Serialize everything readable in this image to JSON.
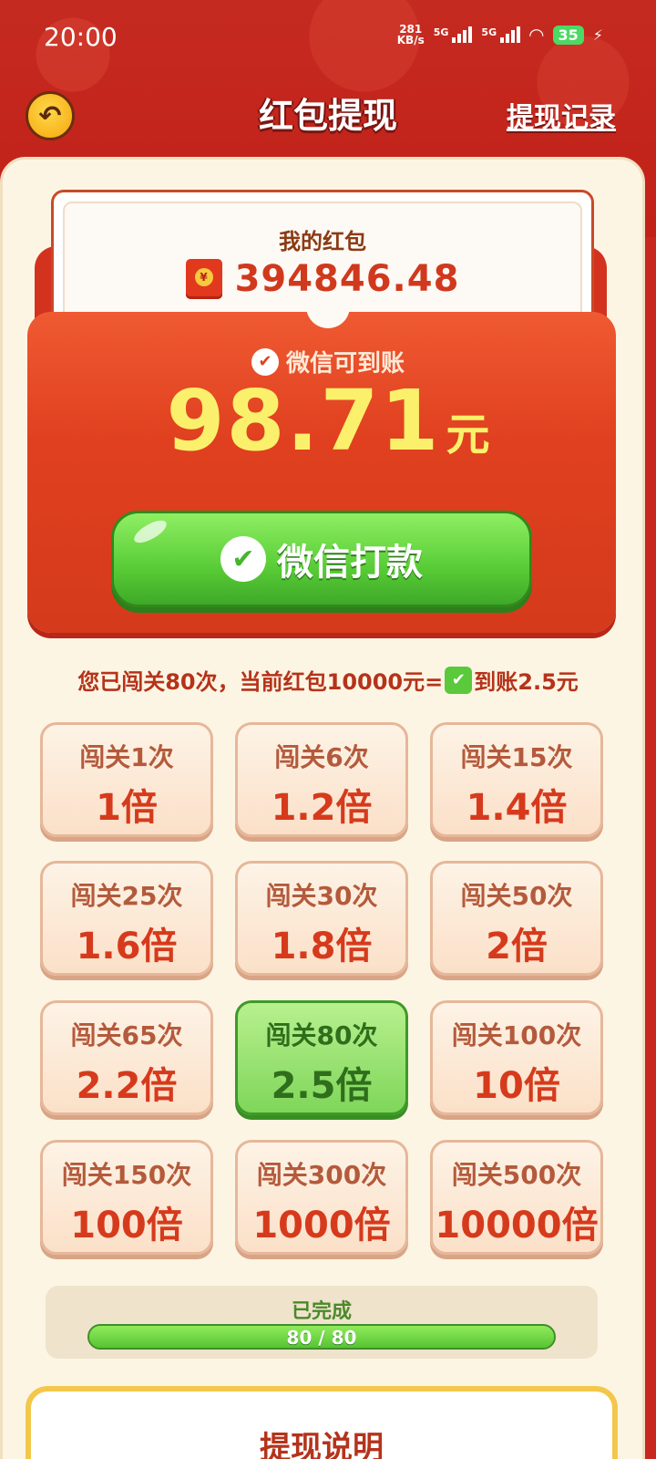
{
  "status_bar": {
    "time": "20:00",
    "net_speed_value": "281",
    "net_speed_unit": "KB/s",
    "signal1_label": "5G",
    "signal2_label": "5G",
    "battery": "35"
  },
  "header": {
    "title": "红包提现",
    "history_link": "提现记录"
  },
  "wallet": {
    "label": "我的红包",
    "amount": "394846.48"
  },
  "withdraw": {
    "wechat_label": "微信可到账",
    "amount": "98.71",
    "unit": "元",
    "button_label": "微信打款"
  },
  "info": {
    "text_before": "您已闯关80次，当前红包10000元=",
    "text_after": "到账2.5元"
  },
  "tiers": [
    {
      "label": "闯关1次",
      "multiplier": "1倍"
    },
    {
      "label": "闯关6次",
      "multiplier": "1.2倍"
    },
    {
      "label": "闯关15次",
      "multiplier": "1.4倍"
    },
    {
      "label": "闯关25次",
      "multiplier": "1.6倍"
    },
    {
      "label": "闯关30次",
      "multiplier": "1.8倍"
    },
    {
      "label": "闯关50次",
      "multiplier": "2倍"
    },
    {
      "label": "闯关65次",
      "multiplier": "2.2倍"
    },
    {
      "label": "闯关80次",
      "multiplier": "2.5倍",
      "active": true
    },
    {
      "label": "闯关100次",
      "multiplier": "10倍"
    },
    {
      "label": "闯关150次",
      "multiplier": "100倍"
    },
    {
      "label": "闯关300次",
      "multiplier": "1000倍"
    },
    {
      "label": "闯关500次",
      "multiplier": "10000倍"
    }
  ],
  "progress": {
    "label": "已完成",
    "text": "80 / 80",
    "fraction": 1.0
  },
  "description": {
    "title": "提现说明"
  },
  "colors": {
    "header_red": "#c52a20",
    "panel_cream": "#fdf5e4",
    "button_green": "#58cc36",
    "amount_yellow": "#fbf06b"
  }
}
